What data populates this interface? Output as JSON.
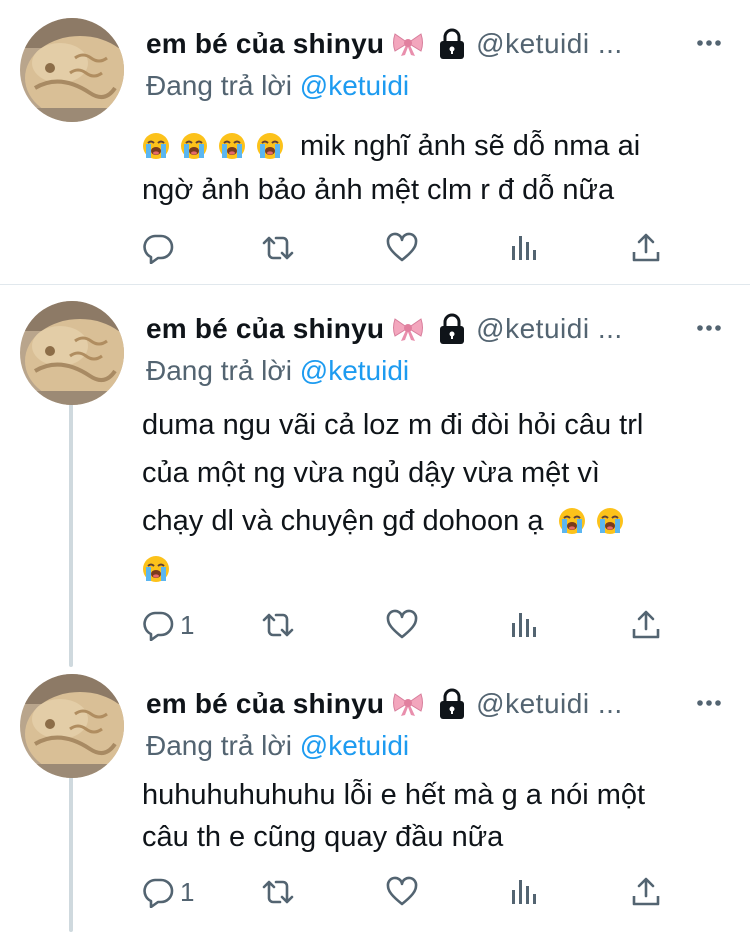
{
  "colors": {
    "accent": "#1d9bf0",
    "muted": "#536471",
    "text": "#0f1419"
  },
  "tweets": [
    {
      "display_name": "em bé của shinyu",
      "handle": "@ketuidi ...",
      "reply_prefix": "Đang trả lời",
      "reply_mention": "@ketuidi",
      "text_line1": "mik nghĩ ảnh sẽ dỗ nma ai",
      "text_line2": "ngờ ảnh bảo ảnh mệt clm r đ dỗ nữa",
      "reply_count": ""
    },
    {
      "display_name": "em bé của shinyu",
      "handle": "@ketuidi ...",
      "reply_prefix": "Đang trả lời",
      "reply_mention": "@ketuidi",
      "text_line1": "duma ngu vãi cả loz m đi đòi hỏi câu trl",
      "text_line2": "của một ng vừa ngủ dậy vừa mệt vì",
      "text_line3": "chạy dl và chuyện gđ dohoon ạ",
      "reply_count": "1"
    },
    {
      "display_name": "em bé của shinyu",
      "handle": "@ketuidi ...",
      "reply_prefix": "Đang trả lời",
      "reply_mention": "@ketuidi",
      "text_line1": "huhuhuhuhuhu lỗi e hết mà g a nói một",
      "text_line2": "câu th e cũng quay đầu nữa",
      "reply_count": "1"
    }
  ],
  "icons": [
    "avatar-image",
    "bow-emoji",
    "lock-icon",
    "more-icon",
    "crying-emoji",
    "reply-icon",
    "retweet-icon",
    "like-icon",
    "analytics-icon",
    "share-icon"
  ]
}
